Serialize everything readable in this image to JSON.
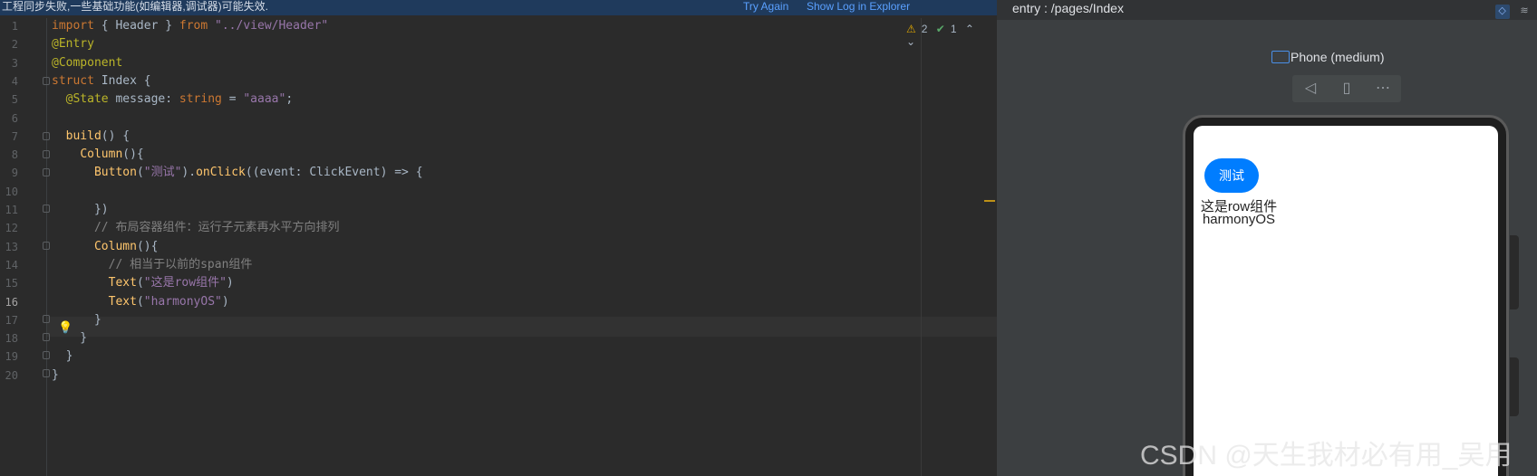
{
  "notification": {
    "message": "工程同步失败,一些基础功能(如编辑器,调试器)可能失效.",
    "try_again": "Try Again",
    "show_log": "Show Log in Explorer"
  },
  "editor": {
    "line_numbers": [
      "1",
      "2",
      "3",
      "4",
      "5",
      "6",
      "7",
      "8",
      "9",
      "10",
      "11",
      "12",
      "13",
      "14",
      "15",
      "16",
      "17",
      "18",
      "19",
      "20"
    ],
    "current_line": "16",
    "inspections": {
      "warnings": "2",
      "ok": "1"
    },
    "lines": [
      "import { Header } from \"../view/Header\"",
      "@Entry",
      "@Component",
      "struct Index {",
      "  @State message: string = \"aaaa\";",
      "",
      "  build() {",
      "    Column(){",
      "      Button(\"测试\").onClick((event: ClickEvent) => {",
      "",
      "      })",
      "      // 布局容器组件：运行子元素再水平方向排列",
      "      Column(){",
      "        // 相当于以前的span组件",
      "        Text(\"这是row组件\")",
      "        Text(\"harmonyOS\")",
      "      }",
      "    }",
      "  }",
      "}"
    ]
  },
  "preview": {
    "title": "entry : /pages/Index",
    "device": "Phone (medium)",
    "toolbar_icons": [
      "back-icon",
      "rotate-icon",
      "more-icon"
    ],
    "app": {
      "button_label": "测试",
      "text1": "这是row组件",
      "text2": "harmonyOS"
    }
  },
  "watermark": "CSDN @天生我材必有用_吴用"
}
